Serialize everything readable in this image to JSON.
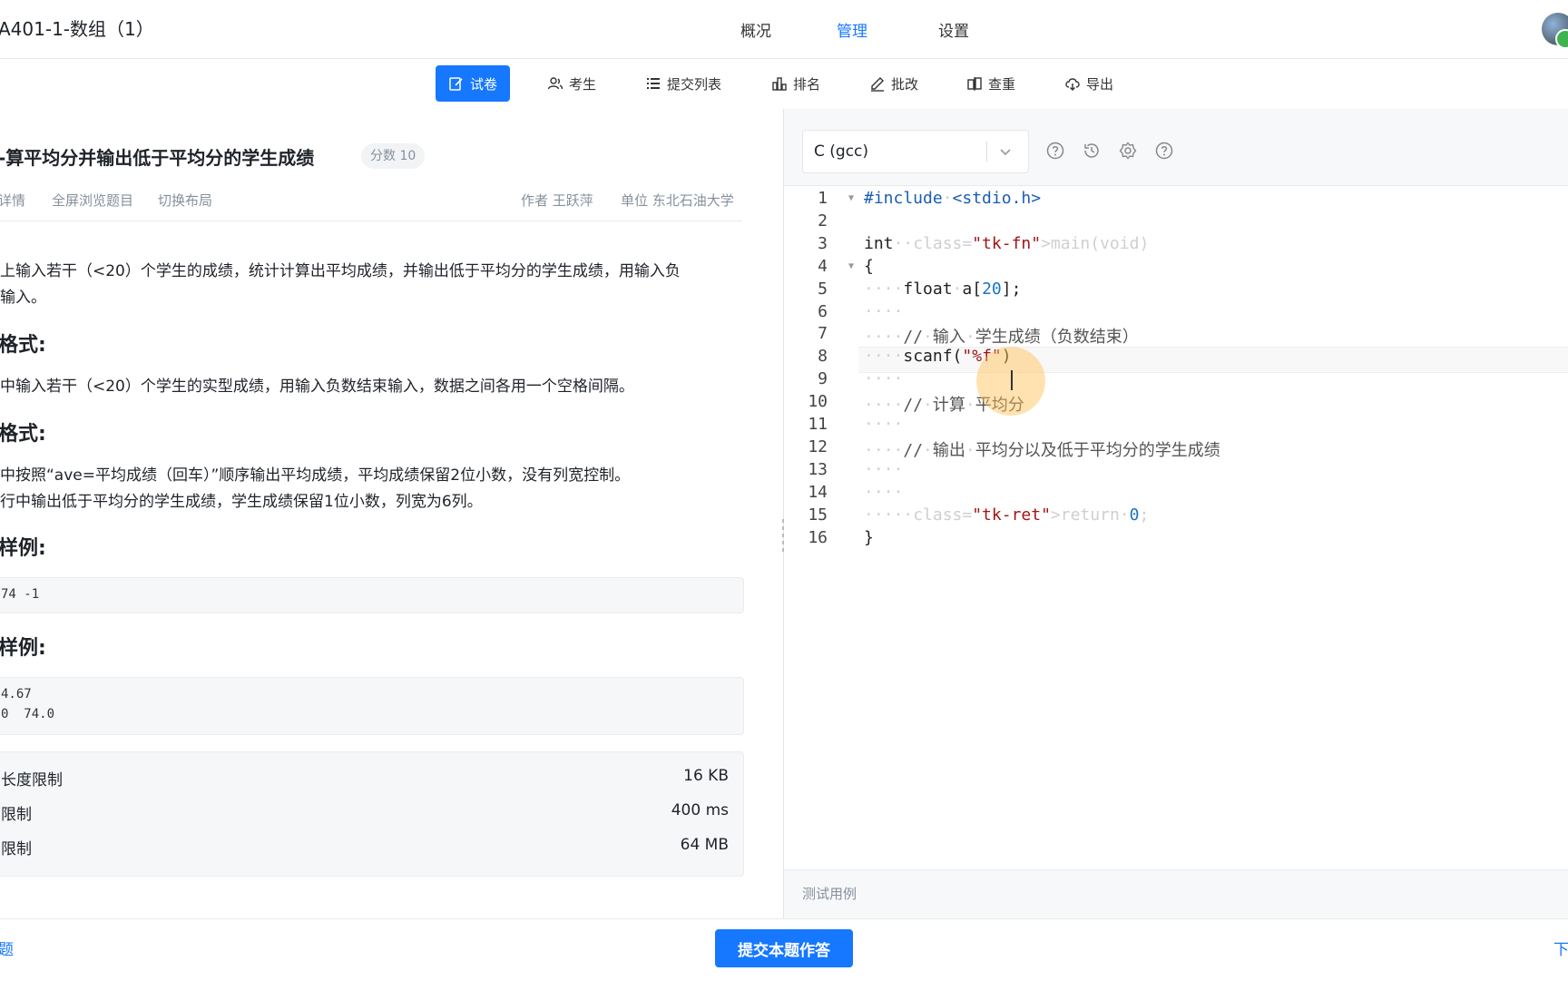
{
  "header": {
    "app_title": "A401-1-数组（1）",
    "nav": [
      "概况",
      "管理",
      "设置"
    ],
    "active_nav": "管理"
  },
  "subnav": {
    "tabs": [
      {
        "label": "试卷",
        "icon": "edit-icon",
        "active": true
      },
      {
        "label": "考生",
        "icon": "users-icon",
        "active": false
      },
      {
        "label": "提交列表",
        "icon": "list-icon",
        "active": false
      },
      {
        "label": "排名",
        "icon": "bar-chart-icon",
        "active": false
      },
      {
        "label": "批改",
        "icon": "pen-icon",
        "active": false
      },
      {
        "label": "查重",
        "icon": "compare-icon",
        "active": false
      },
      {
        "label": "导出",
        "icon": "cloud-download-icon",
        "active": false
      }
    ]
  },
  "question": {
    "title": "算平均分并输出低于平均分的学生成绩",
    "title_prefix": "-",
    "score": "分数 10",
    "links": [
      "详情",
      "全屏浏览题目",
      "切换布局"
    ],
    "author": "作者 王跃萍",
    "unit": "单位 东北石油大学",
    "desc_lines": [
      "上输入若干（<20）个学生的成绩，统计计算出平均成绩，并输出低于平均分的学生成绩，用输入负",
      "输入。"
    ],
    "input_heading": "格式:",
    "input_text": "中输入若干（<20）个学生的实型成绩，用输入负数结束输入，数据之间各用一个空格间隔。",
    "output_heading": "格式:",
    "output_lines": [
      "中按照“ave=平均成绩（回车）”顺序输出平均成绩，平均成绩保留2位小数，没有列宽控制。",
      "行中输出低于平均分的学生成绩，学生成绩保留1位小数，列宽为6列。"
    ],
    "sample_in_heading": "样例:",
    "sample_in": [
      "74 -1"
    ],
    "sample_out_heading": "样例:",
    "sample_out": [
      "4.67",
      "0  74.0"
    ],
    "limits": [
      {
        "key": "长度限制",
        "value": "16 KB"
      },
      {
        "key": "限制",
        "value": "400 ms"
      },
      {
        "key": "限制",
        "value": "64 MB"
      }
    ]
  },
  "editor": {
    "language": "C (gcc)",
    "toolbar_icons": [
      "help-circle-icon",
      "history-icon",
      "settings-icon",
      "question-icon"
    ],
    "line_numbers": [
      "1",
      "2",
      "3",
      "4",
      "5",
      "6",
      "7",
      "8",
      "9",
      "10",
      "11",
      "12",
      "13",
      "14",
      "15",
      "16"
    ],
    "lines": [
      "#include <stdio.h>",
      "",
      "int main(void)",
      "{",
      "    float a[20];",
      "    ",
      "    // 输入 学生成绩（负数结束）",
      "    scanf(\"%f\")",
      "    ",
      "    // 计算 平均分",
      "    ",
      "    // 输出 平均分以及低于平均分的学生成绩",
      "    ",
      "    ",
      "    return 0;",
      "}"
    ],
    "active_line": 8,
    "test_label": "测试用例"
  },
  "footer": {
    "prev": "题",
    "submit": "提交本题作答",
    "next": "下"
  },
  "colors": {
    "accent": "#1677ff",
    "muted": "#86909c"
  }
}
